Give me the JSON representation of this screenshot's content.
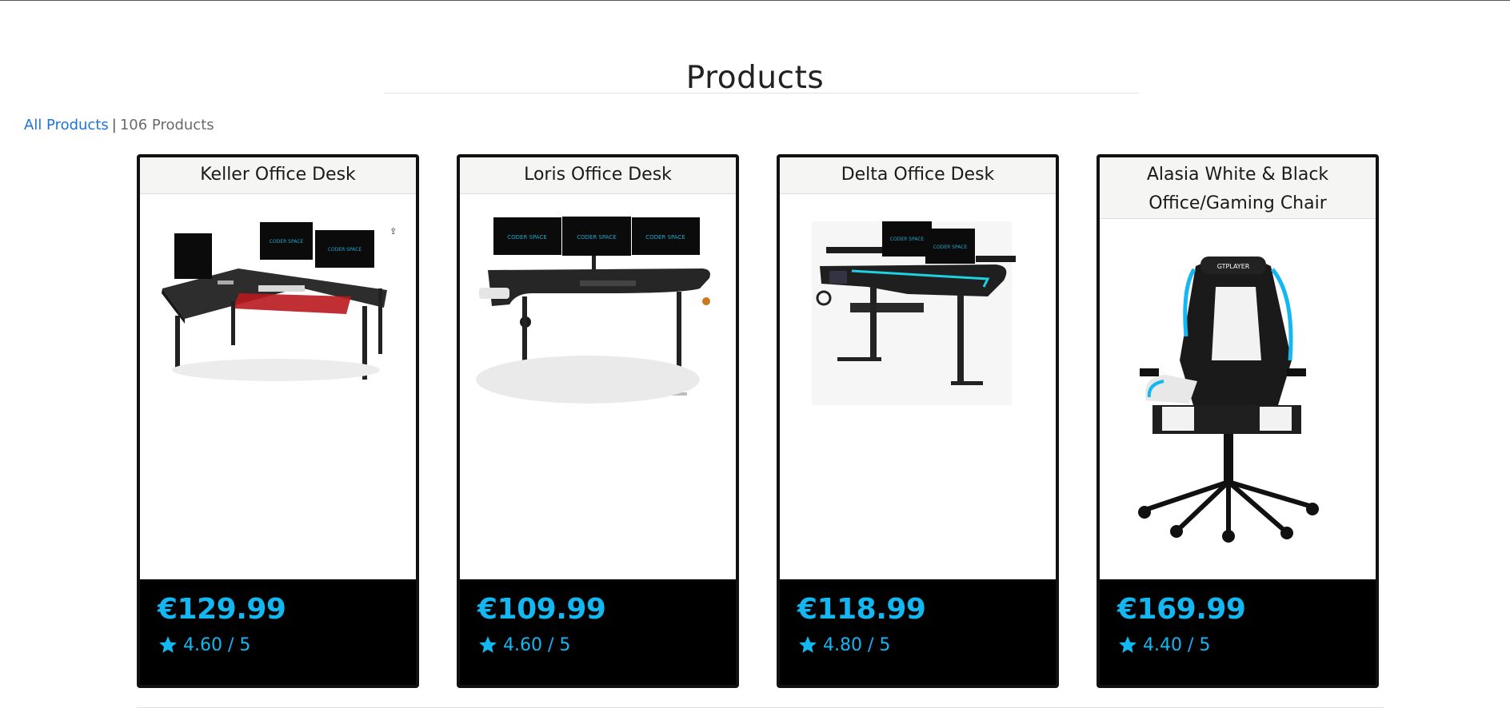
{
  "page": {
    "title": "Products",
    "breadcrumb": {
      "link": "All Products",
      "separator": "|",
      "count": "106 Products"
    }
  },
  "colors": {
    "accent": "#13b7f2",
    "link": "#1e73d8",
    "card_border": "#111111",
    "footer_bg": "#000000"
  },
  "products": [
    {
      "name": "Keller Office Desk",
      "price": "€129.99",
      "rating": "4.60 / 5",
      "image_icon": "l-shaped-desk-icon"
    },
    {
      "name": "Loris Office Desk",
      "price": "€109.99",
      "rating": "4.60 / 5",
      "image_icon": "gaming-desk-icon"
    },
    {
      "name": "Delta Office Desk",
      "price": "€118.99",
      "rating": "4.80 / 5",
      "image_icon": "standing-desk-icon"
    },
    {
      "name": "Alasia White & Black Office/Gaming Chair",
      "price": "€169.99",
      "rating": "4.40 / 5",
      "image_icon": "gaming-chair-icon"
    }
  ]
}
